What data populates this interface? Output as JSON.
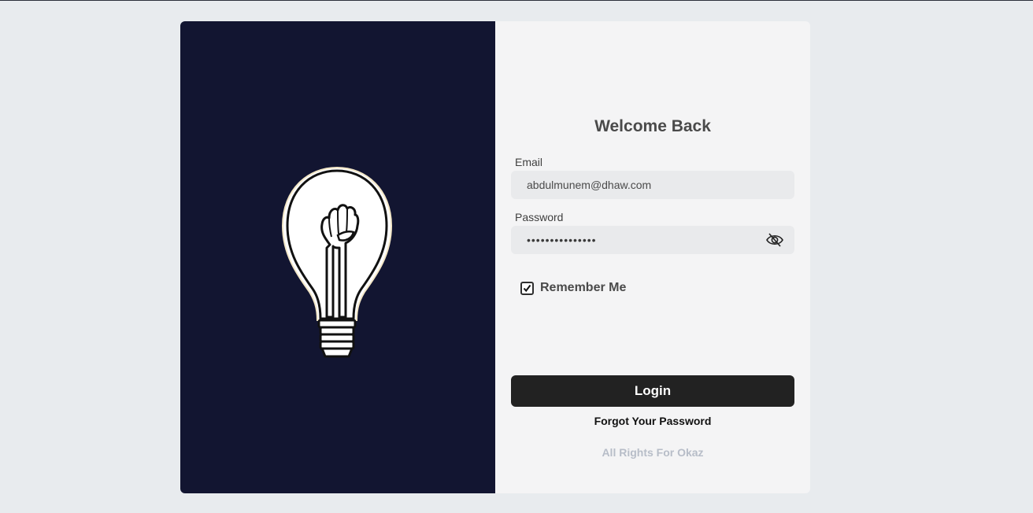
{
  "login": {
    "title": "Welcome Back",
    "email_label": "Email",
    "email_value": "abdulmunem@dhaw.com",
    "password_label": "Password",
    "password_masked": "•••••••••••••••",
    "remember_label": "Remember Me",
    "remember_checked": true,
    "login_button": "Login",
    "forgot_link": "Forgot Your Password",
    "footer": "All Rights For Okaz"
  },
  "colors": {
    "page_background": "#e8ebee",
    "left_panel": "#121531",
    "right_panel": "#f4f4f5",
    "button": "#222222",
    "footer_text": "#b7bdc8"
  },
  "icons": {
    "illustration": "lightbulb-fist-icon",
    "password_toggle": "eye-slash-icon",
    "checkbox": "check-icon"
  }
}
